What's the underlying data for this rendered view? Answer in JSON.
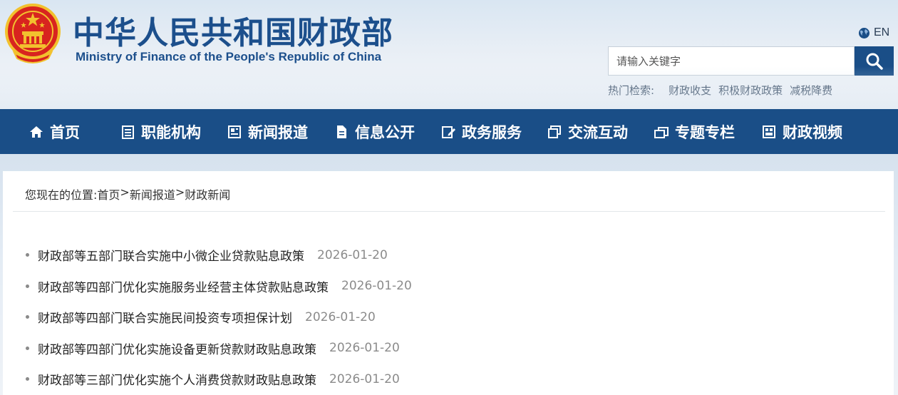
{
  "header": {
    "title_cn": "中华人民共和国财政部",
    "title_en": "Ministry of Finance of the People's Republic of China",
    "lang_label": "EN",
    "search_placeholder": "请输入关键字",
    "hot_label": "热门检索:",
    "hot_links": [
      "财政收支",
      "积极财政政策",
      "减税降费"
    ]
  },
  "nav": {
    "items": [
      {
        "label": "首页",
        "icon": "home-icon"
      },
      {
        "label": "职能机构",
        "icon": "list-icon"
      },
      {
        "label": "新闻报道",
        "icon": "newspaper-icon"
      },
      {
        "label": "信息公开",
        "icon": "document-icon"
      },
      {
        "label": "政务服务",
        "icon": "edit-icon"
      },
      {
        "label": "交流互动",
        "icon": "chat-icon"
      },
      {
        "label": "专题专栏",
        "icon": "folder-icon"
      },
      {
        "label": "财政视频",
        "icon": "video-icon"
      }
    ]
  },
  "breadcrumb": {
    "prefix": "您现在的位置:",
    "items": [
      "首页",
      "新闻报道",
      "财政新闻"
    ],
    "sep": ">"
  },
  "news": [
    {
      "title": "财政部等五部门联合实施中小微企业贷款贴息政策",
      "date": "2026-01-20"
    },
    {
      "title": "财政部等四部门优化实施服务业经营主体贷款贴息政策",
      "date": "2026-01-20"
    },
    {
      "title": "财政部等四部门联合实施民间投资专项担保计划",
      "date": "2026-01-20"
    },
    {
      "title": "财政部等四部门优化实施设备更新贷款财政贴息政策",
      "date": "2026-01-20"
    },
    {
      "title": "财政部等三部门优化实施个人消费贷款财政贴息政策",
      "date": "2026-01-20"
    }
  ],
  "colors": {
    "brand_blue": "#1a4e87",
    "title_blue": "#1c4f8c",
    "emblem_red": "#d8241f",
    "emblem_gold": "#f2c12e"
  }
}
